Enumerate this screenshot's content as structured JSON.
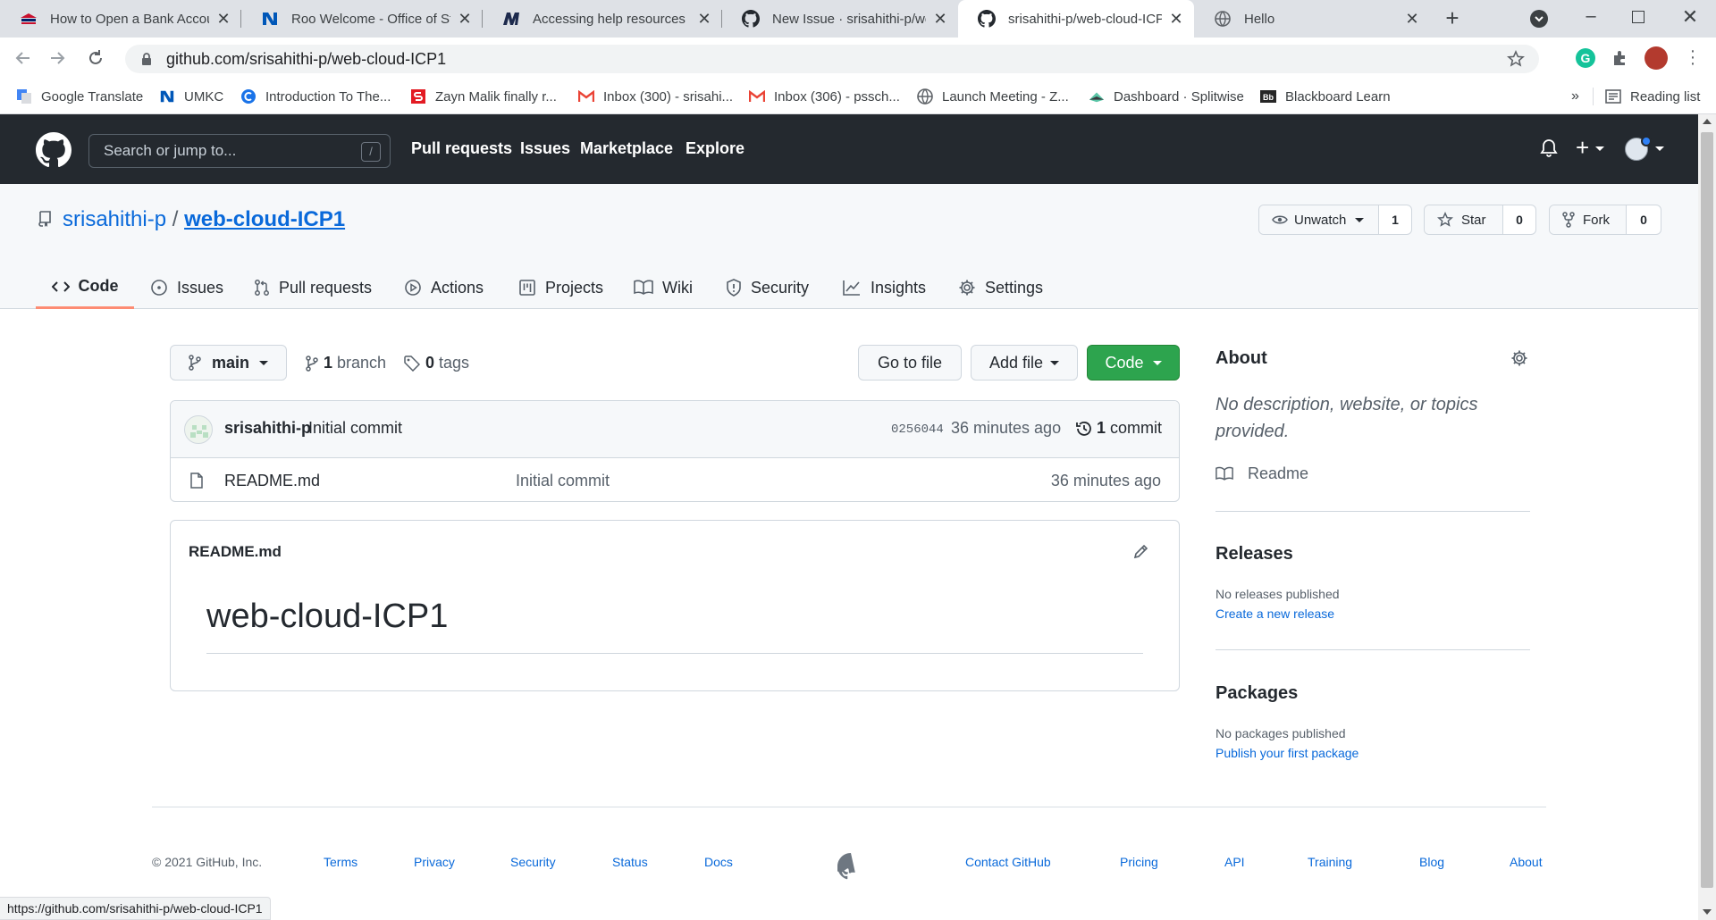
{
  "browser": {
    "tabs": [
      {
        "title": "How to Open a Bank Accou",
        "favicon": "bank-icon"
      },
      {
        "title": "Roo Welcome - Office of St",
        "favicon": "umkc-icon"
      },
      {
        "title": "Accessing help resources |",
        "favicon": "m-icon"
      },
      {
        "title": "New Issue · srisahithi-p/we",
        "favicon": "github-icon"
      },
      {
        "title": "srisahithi-p/web-cloud-ICP",
        "favicon": "github-icon"
      },
      {
        "title": "Hello",
        "favicon": "globe-icon"
      }
    ],
    "url": "github.com/srisahithi-p/web-cloud-ICP1",
    "bookmarks": [
      "Google Translate",
      "UMKC",
      "Introduction To The...",
      "Zayn Malik finally r...",
      "Inbox (300) - srisahi...",
      "Inbox (306) - pssch...",
      "Launch Meeting - Z...",
      "Dashboard · Splitwise",
      "Blackboard Learn"
    ],
    "more_bookmarks": "»",
    "reading_list": "Reading list",
    "status_url": "https://github.com/srisahithi-p/web-cloud-ICP1"
  },
  "github_header": {
    "search_placeholder": "Search or jump to...",
    "search_shortcut": "/",
    "nav": [
      "Pull requests",
      "Issues",
      "Marketplace",
      "Explore"
    ]
  },
  "repo": {
    "owner": "srisahithi-p",
    "separator": "/",
    "name": "web-cloud-ICP1",
    "watch_label": "Unwatch",
    "watch_count": "1",
    "star_label": "Star",
    "star_count": "0",
    "fork_label": "Fork",
    "fork_count": "0",
    "tabs": [
      "Code",
      "Issues",
      "Pull requests",
      "Actions",
      "Projects",
      "Wiki",
      "Security",
      "Insights",
      "Settings"
    ]
  },
  "code": {
    "branch": "main",
    "branch_count": "1",
    "branch_label": "branch",
    "tag_count": "0",
    "tag_label": "tags",
    "go_to_file": "Go to file",
    "add_file": "Add file",
    "code_button": "Code",
    "commit": {
      "author": "srisahithi-p",
      "message": "Initial commit",
      "sha": "0256044",
      "time": "36 minutes ago",
      "count": "1",
      "count_label": "commit"
    },
    "files": [
      {
        "name": "README.md",
        "message": "Initial commit",
        "time": "36 minutes ago"
      }
    ],
    "readme_filename": "README.md",
    "readme_heading": "web-cloud-ICP1"
  },
  "sidebar": {
    "about_title": "About",
    "about_text": "No description, website, or topics provided.",
    "readme_link": "Readme",
    "releases_title": "Releases",
    "releases_text": "No releases published",
    "releases_link": "Create a new release",
    "packages_title": "Packages",
    "packages_text": "No packages published",
    "packages_link": "Publish your first package"
  },
  "footer": {
    "copyright": "© 2021 GitHub, Inc.",
    "links_left": [
      "Terms",
      "Privacy",
      "Security",
      "Status",
      "Docs"
    ],
    "links_right": [
      "Contact GitHub",
      "Pricing",
      "API",
      "Training",
      "Blog",
      "About"
    ]
  },
  "colors": {
    "header_bg": "#24292f",
    "link": "#0969da",
    "code_green": "#2da44e",
    "tab_underline": "#fd8c73"
  }
}
